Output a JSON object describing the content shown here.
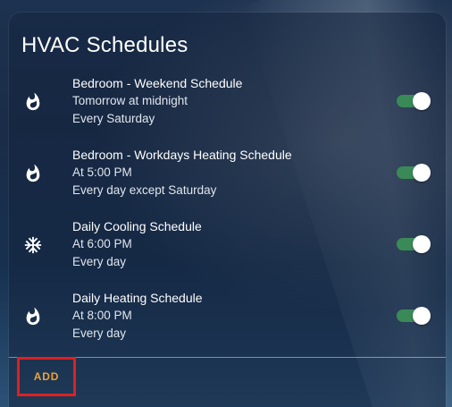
{
  "card": {
    "title": "HVAC Schedules",
    "add_label": "ADD"
  },
  "colors": {
    "toggle_on": "#3a8a57",
    "add_text": "#f0a03a",
    "highlight_border": "#e02020"
  },
  "schedules": [
    {
      "name": "Bedroom - Weekend Schedule",
      "time": "Tomorrow at midnight",
      "repeat": "Every Saturday",
      "icon": "flame-icon",
      "enabled": true
    },
    {
      "name": "Bedroom - Workdays Heating Schedule",
      "time": "At 5:00 PM",
      "repeat": "Every day except Saturday",
      "icon": "flame-icon",
      "enabled": true
    },
    {
      "name": "Daily Cooling Schedule",
      "time": "At 6:00 PM",
      "repeat": "Every day",
      "icon": "snowflake-icon",
      "enabled": true
    },
    {
      "name": "Daily Heating Schedule",
      "time": "At 8:00 PM",
      "repeat": "Every day",
      "icon": "flame-icon",
      "enabled": true
    }
  ]
}
